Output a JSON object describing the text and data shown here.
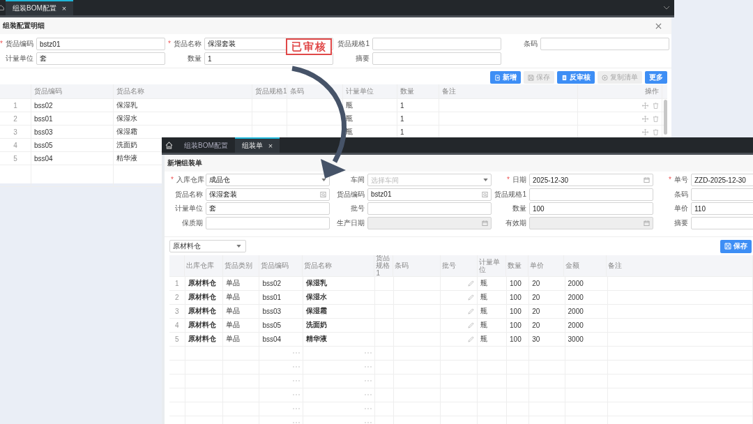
{
  "back_window": {
    "tabs": [
      {
        "label": "组装BOM配置",
        "selected": true,
        "close": "×"
      }
    ],
    "panel_title": "组装配置明细",
    "fields": [
      {
        "label": "货品编码",
        "required_mark": "*",
        "value": "bstz01"
      },
      {
        "label": "货品名称",
        "required_mark": "*",
        "value": "保湿套装"
      },
      {
        "label": "货品规格1"
      },
      {
        "label": "条码"
      },
      {
        "label": "计量单位",
        "value": "套"
      },
      {
        "label": "数量",
        "value": "1"
      },
      {
        "label": "摘要"
      }
    ],
    "stamp": "已审核",
    "buttons": [
      {
        "label": "新增",
        "disabled": false
      },
      {
        "label": "保存",
        "disabled": true
      },
      {
        "label": "反审核",
        "disabled": false
      },
      {
        "label": "复制清单",
        "disabled": true
      },
      {
        "label": "更多",
        "disabled": false
      }
    ],
    "table": {
      "columns": [
        "货品编码",
        "货品名称",
        "货品规格1",
        "条码",
        "计量单位",
        "数量",
        "备注",
        "操作"
      ],
      "rows": [
        {
          "index": "1",
          "item_code": "bss02",
          "item_name": "保湿乳",
          "unit": "瓶",
          "quantity": "1"
        },
        {
          "index": "2",
          "item_code": "bss01",
          "item_name": "保湿水",
          "unit": "瓶",
          "quantity": "1"
        },
        {
          "index": "3",
          "item_code": "bss03",
          "item_name": "保湿霜",
          "unit": "瓶",
          "quantity": "1"
        },
        {
          "index": "4",
          "item_code": "bss05",
          "item_name": "洗面奶"
        },
        {
          "index": "5",
          "item_code": "bss04",
          "item_name": "精华液"
        }
      ]
    }
  },
  "front_window": {
    "tabs": [
      {
        "label": "组装BOM配置",
        "selected": false
      },
      {
        "label": "组装单",
        "selected": true,
        "close": "×"
      }
    ],
    "panel_title": "新增组装单",
    "fields": [
      {
        "label": "入库仓库",
        "required_mark": "*",
        "kind": "select",
        "value": "成品仓",
        "disabled": false
      },
      {
        "label": "车间",
        "kind": "select",
        "placeholder": "选择车间",
        "disabled": false
      },
      {
        "label": "日期",
        "required_mark": "*",
        "kind": "date",
        "value": "2025-12-30",
        "disabled": false
      },
      {
        "label": "单号",
        "required_mark": "*",
        "kind": "text",
        "value": "ZZD-2025-12-30",
        "disabled": false
      },
      {
        "label": "货品名称",
        "kind": "lookup",
        "value": "保湿套装",
        "disabled": false
      },
      {
        "label": "货品编码",
        "kind": "lookup",
        "value": "bstz01",
        "disabled": false
      },
      {
        "label": "货品规格1",
        "kind": "text",
        "disabled": false
      },
      {
        "label": "条码",
        "kind": "text",
        "disabled": false
      },
      {
        "label": "计量单位",
        "kind": "text",
        "value": "套",
        "disabled": false
      },
      {
        "label": "批号",
        "kind": "text",
        "disabled": false
      },
      {
        "label": "数量",
        "kind": "text",
        "value": "100",
        "disabled": false
      },
      {
        "label": "单价",
        "kind": "text",
        "value": "110",
        "disabled": false
      },
      {
        "label": "保质期",
        "kind": "text",
        "disabled": false
      },
      {
        "label": "生产日期",
        "kind": "date",
        "disabled": true
      },
      {
        "label": "有效期",
        "kind": "date",
        "disabled": true
      },
      {
        "label": "摘要",
        "kind": "text",
        "disabled": false
      }
    ],
    "warehouse_select": "原材料仓",
    "save_button": "保存",
    "table": {
      "columns": [
        "出库仓库",
        "货品类别",
        "货品编码",
        "货品名称",
        "货品规格1",
        "条码",
        "批号",
        "计量单位",
        "数量",
        "单价",
        "金额",
        "备注"
      ],
      "rows": [
        {
          "index": "1",
          "warehouse": "原材料仓",
          "category": "单品",
          "item_code": "bss02",
          "item_name": "保湿乳",
          "unit": "瓶",
          "quantity": "100",
          "unit_price": "20",
          "amount": "2000"
        },
        {
          "index": "2",
          "warehouse": "原材料仓",
          "category": "单品",
          "item_code": "bss01",
          "item_name": "保湿水",
          "unit": "瓶",
          "quantity": "100",
          "unit_price": "20",
          "amount": "2000"
        },
        {
          "index": "3",
          "warehouse": "原材料仓",
          "category": "单品",
          "item_code": "bss03",
          "item_name": "保湿霜",
          "unit": "瓶",
          "quantity": "100",
          "unit_price": "20",
          "amount": "2000"
        },
        {
          "index": "4",
          "warehouse": "原材料仓",
          "category": "单品",
          "item_code": "bss05",
          "item_name": "洗面奶",
          "unit": "瓶",
          "quantity": "100",
          "unit_price": "20",
          "amount": "2000"
        },
        {
          "index": "5",
          "warehouse": "原材料仓",
          "category": "单品",
          "item_code": "bss04",
          "item_name": "精华液",
          "unit": "瓶",
          "quantity": "100",
          "unit_price": "30",
          "amount": "3000"
        }
      ]
    }
  }
}
